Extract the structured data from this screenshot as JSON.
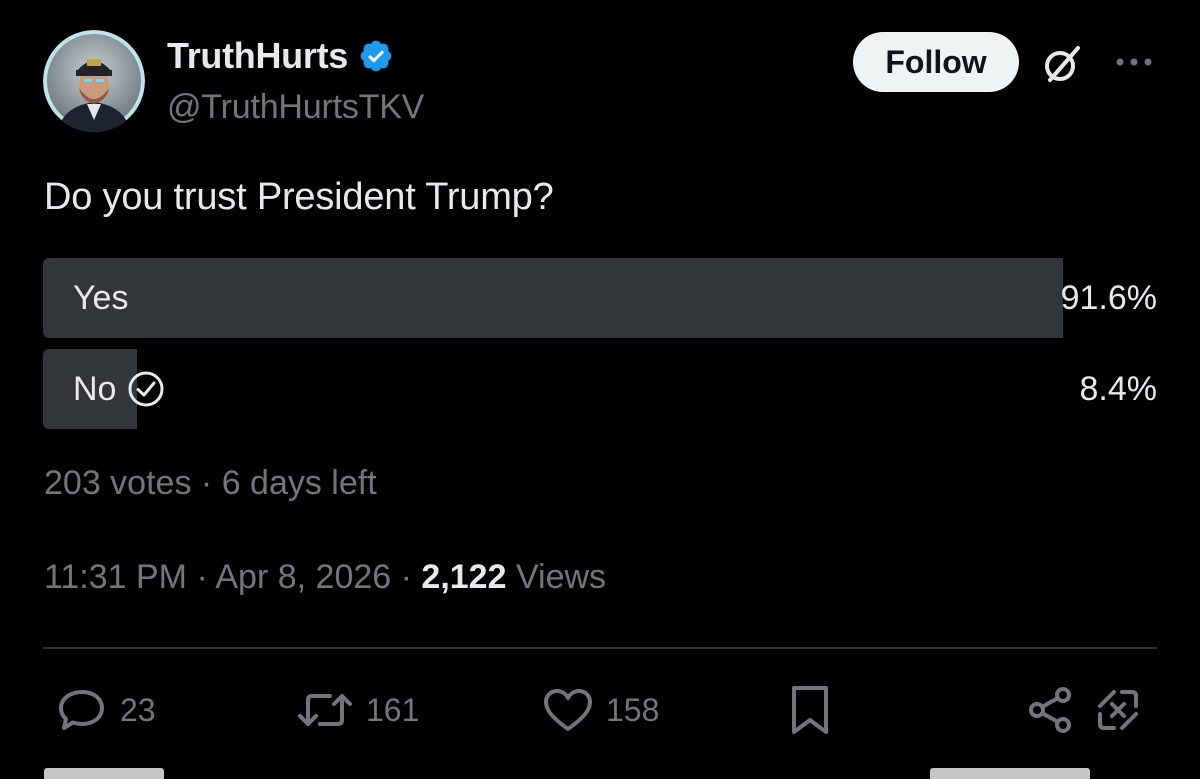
{
  "author": {
    "display_name": "TruthHurts",
    "handle": "@TruthHurtsTKV",
    "verified": true
  },
  "header": {
    "follow_label": "Follow"
  },
  "post": {
    "question": "Do you trust President Trump?"
  },
  "poll": {
    "options": [
      {
        "label": "Yes",
        "percent": "91.6%",
        "value": 91.6,
        "selected": false
      },
      {
        "label": "No",
        "percent": "8.4%",
        "value": 8.4,
        "selected": true
      }
    ],
    "votes": "203 votes",
    "separator": "·",
    "time_left": "6 days left"
  },
  "meta": {
    "time": "11:31 PM",
    "date": "Apr 8, 2026",
    "views_count": "2,122",
    "views_label": "Views",
    "separator": "·"
  },
  "actions": {
    "replies": "23",
    "reposts": "161",
    "likes": "158"
  },
  "icons": {
    "verified": "verified-badge-icon",
    "grok": "grok-icon",
    "more": "more-dots-icon",
    "check": "check-circle-icon",
    "reply": "reply-icon",
    "repost": "repost-icon",
    "like": "heart-icon",
    "bookmark": "bookmark-icon",
    "share": "share-icon",
    "grok_action": "grok-action-icon"
  },
  "colors": {
    "background": "#000000",
    "text_primary": "#e7e9ea",
    "text_secondary": "#71767b",
    "verified_blue": "#1d9bf0",
    "poll_bar": "#333639",
    "divider": "#2f3336",
    "follow_bg": "#eff3f4"
  }
}
